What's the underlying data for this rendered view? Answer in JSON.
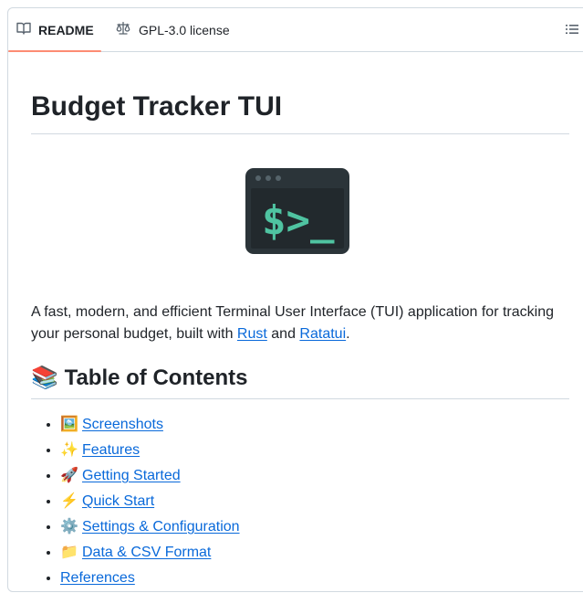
{
  "tabs": {
    "readme": {
      "icon": "book-icon",
      "label": "README"
    },
    "license": {
      "icon": "scale-icon",
      "label": "GPL-3.0 license"
    },
    "outline": {
      "icon": "list-icon"
    }
  },
  "readme": {
    "title": "Budget Tracker TUI",
    "logo": {
      "icon": "terminal-icon",
      "text": "$>_"
    },
    "description": {
      "before": "A fast, modern, and efficient Terminal User Interface (TUI) application for tracking your personal budget, built with ",
      "link1": "Rust",
      "middle": " and ",
      "link2": "Ratatui",
      "after": "."
    },
    "toc_heading": {
      "emoji": "📚",
      "text": "Table of Contents"
    },
    "toc_items": [
      {
        "emoji": "🖼️",
        "label": "Screenshots"
      },
      {
        "emoji": "✨",
        "label": "Features"
      },
      {
        "emoji": "🚀",
        "label": "Getting Started"
      },
      {
        "emoji": "⚡",
        "label": "Quick Start"
      },
      {
        "emoji": "⚙️",
        "label": "Settings & Configuration"
      },
      {
        "emoji": "📁",
        "label": "Data & CSV Format"
      },
      {
        "emoji": "",
        "label": "References"
      }
    ]
  },
  "colors": {
    "accent": "#fd8c73",
    "link": "#0969da",
    "logo_bg": "#2b3439",
    "logo_fg": "#4fc3a1"
  }
}
